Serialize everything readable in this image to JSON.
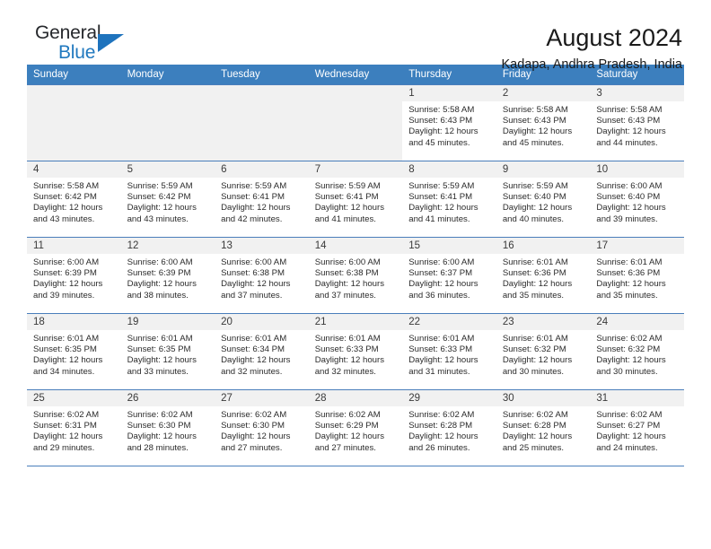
{
  "brand": {
    "name_top": "General",
    "name_bottom": "Blue",
    "triangle_color": "#1e73bd",
    "blue_text_color": "#2179bf"
  },
  "header": {
    "title": "August 2024",
    "subtitle": "Kadapa, Andhra Pradesh, India",
    "header_bg_color": "#3c7fbe",
    "header_text_color": "#ffffff"
  },
  "calendar": {
    "weekday_headers": [
      "Sunday",
      "Monday",
      "Tuesday",
      "Wednesday",
      "Thursday",
      "Friday",
      "Saturday"
    ],
    "weeks": [
      [
        {
          "day": "",
          "empty": true
        },
        {
          "day": "",
          "empty": true
        },
        {
          "day": "",
          "empty": true
        },
        {
          "day": "",
          "empty": true
        },
        {
          "day": "1",
          "sunrise": "Sunrise: 5:58 AM",
          "sunset": "Sunset: 6:43 PM",
          "daylight_1": "Daylight: 12 hours",
          "daylight_2": "and 45 minutes."
        },
        {
          "day": "2",
          "sunrise": "Sunrise: 5:58 AM",
          "sunset": "Sunset: 6:43 PM",
          "daylight_1": "Daylight: 12 hours",
          "daylight_2": "and 45 minutes."
        },
        {
          "day": "3",
          "sunrise": "Sunrise: 5:58 AM",
          "sunset": "Sunset: 6:43 PM",
          "daylight_1": "Daylight: 12 hours",
          "daylight_2": "and 44 minutes."
        }
      ],
      [
        {
          "day": "4",
          "sunrise": "Sunrise: 5:58 AM",
          "sunset": "Sunset: 6:42 PM",
          "daylight_1": "Daylight: 12 hours",
          "daylight_2": "and 43 minutes."
        },
        {
          "day": "5",
          "sunrise": "Sunrise: 5:59 AM",
          "sunset": "Sunset: 6:42 PM",
          "daylight_1": "Daylight: 12 hours",
          "daylight_2": "and 43 minutes."
        },
        {
          "day": "6",
          "sunrise": "Sunrise: 5:59 AM",
          "sunset": "Sunset: 6:41 PM",
          "daylight_1": "Daylight: 12 hours",
          "daylight_2": "and 42 minutes."
        },
        {
          "day": "7",
          "sunrise": "Sunrise: 5:59 AM",
          "sunset": "Sunset: 6:41 PM",
          "daylight_1": "Daylight: 12 hours",
          "daylight_2": "and 41 minutes."
        },
        {
          "day": "8",
          "sunrise": "Sunrise: 5:59 AM",
          "sunset": "Sunset: 6:41 PM",
          "daylight_1": "Daylight: 12 hours",
          "daylight_2": "and 41 minutes."
        },
        {
          "day": "9",
          "sunrise": "Sunrise: 5:59 AM",
          "sunset": "Sunset: 6:40 PM",
          "daylight_1": "Daylight: 12 hours",
          "daylight_2": "and 40 minutes."
        },
        {
          "day": "10",
          "sunrise": "Sunrise: 6:00 AM",
          "sunset": "Sunset: 6:40 PM",
          "daylight_1": "Daylight: 12 hours",
          "daylight_2": "and 39 minutes."
        }
      ],
      [
        {
          "day": "11",
          "sunrise": "Sunrise: 6:00 AM",
          "sunset": "Sunset: 6:39 PM",
          "daylight_1": "Daylight: 12 hours",
          "daylight_2": "and 39 minutes."
        },
        {
          "day": "12",
          "sunrise": "Sunrise: 6:00 AM",
          "sunset": "Sunset: 6:39 PM",
          "daylight_1": "Daylight: 12 hours",
          "daylight_2": "and 38 minutes."
        },
        {
          "day": "13",
          "sunrise": "Sunrise: 6:00 AM",
          "sunset": "Sunset: 6:38 PM",
          "daylight_1": "Daylight: 12 hours",
          "daylight_2": "and 37 minutes."
        },
        {
          "day": "14",
          "sunrise": "Sunrise: 6:00 AM",
          "sunset": "Sunset: 6:38 PM",
          "daylight_1": "Daylight: 12 hours",
          "daylight_2": "and 37 minutes."
        },
        {
          "day": "15",
          "sunrise": "Sunrise: 6:00 AM",
          "sunset": "Sunset: 6:37 PM",
          "daylight_1": "Daylight: 12 hours",
          "daylight_2": "and 36 minutes."
        },
        {
          "day": "16",
          "sunrise": "Sunrise: 6:01 AM",
          "sunset": "Sunset: 6:36 PM",
          "daylight_1": "Daylight: 12 hours",
          "daylight_2": "and 35 minutes."
        },
        {
          "day": "17",
          "sunrise": "Sunrise: 6:01 AM",
          "sunset": "Sunset: 6:36 PM",
          "daylight_1": "Daylight: 12 hours",
          "daylight_2": "and 35 minutes."
        }
      ],
      [
        {
          "day": "18",
          "sunrise": "Sunrise: 6:01 AM",
          "sunset": "Sunset: 6:35 PM",
          "daylight_1": "Daylight: 12 hours",
          "daylight_2": "and 34 minutes."
        },
        {
          "day": "19",
          "sunrise": "Sunrise: 6:01 AM",
          "sunset": "Sunset: 6:35 PM",
          "daylight_1": "Daylight: 12 hours",
          "daylight_2": "and 33 minutes."
        },
        {
          "day": "20",
          "sunrise": "Sunrise: 6:01 AM",
          "sunset": "Sunset: 6:34 PM",
          "daylight_1": "Daylight: 12 hours",
          "daylight_2": "and 32 minutes."
        },
        {
          "day": "21",
          "sunrise": "Sunrise: 6:01 AM",
          "sunset": "Sunset: 6:33 PM",
          "daylight_1": "Daylight: 12 hours",
          "daylight_2": "and 32 minutes."
        },
        {
          "day": "22",
          "sunrise": "Sunrise: 6:01 AM",
          "sunset": "Sunset: 6:33 PM",
          "daylight_1": "Daylight: 12 hours",
          "daylight_2": "and 31 minutes."
        },
        {
          "day": "23",
          "sunrise": "Sunrise: 6:01 AM",
          "sunset": "Sunset: 6:32 PM",
          "daylight_1": "Daylight: 12 hours",
          "daylight_2": "and 30 minutes."
        },
        {
          "day": "24",
          "sunrise": "Sunrise: 6:02 AM",
          "sunset": "Sunset: 6:32 PM",
          "daylight_1": "Daylight: 12 hours",
          "daylight_2": "and 30 minutes."
        }
      ],
      [
        {
          "day": "25",
          "sunrise": "Sunrise: 6:02 AM",
          "sunset": "Sunset: 6:31 PM",
          "daylight_1": "Daylight: 12 hours",
          "daylight_2": "and 29 minutes."
        },
        {
          "day": "26",
          "sunrise": "Sunrise: 6:02 AM",
          "sunset": "Sunset: 6:30 PM",
          "daylight_1": "Daylight: 12 hours",
          "daylight_2": "and 28 minutes."
        },
        {
          "day": "27",
          "sunrise": "Sunrise: 6:02 AM",
          "sunset": "Sunset: 6:30 PM",
          "daylight_1": "Daylight: 12 hours",
          "daylight_2": "and 27 minutes."
        },
        {
          "day": "28",
          "sunrise": "Sunrise: 6:02 AM",
          "sunset": "Sunset: 6:29 PM",
          "daylight_1": "Daylight: 12 hours",
          "daylight_2": "and 27 minutes."
        },
        {
          "day": "29",
          "sunrise": "Sunrise: 6:02 AM",
          "sunset": "Sunset: 6:28 PM",
          "daylight_1": "Daylight: 12 hours",
          "daylight_2": "and 26 minutes."
        },
        {
          "day": "30",
          "sunrise": "Sunrise: 6:02 AM",
          "sunset": "Sunset: 6:28 PM",
          "daylight_1": "Daylight: 12 hours",
          "daylight_2": "and 25 minutes."
        },
        {
          "day": "31",
          "sunrise": "Sunrise: 6:02 AM",
          "sunset": "Sunset: 6:27 PM",
          "daylight_1": "Daylight: 12 hours",
          "daylight_2": "and 24 minutes."
        }
      ]
    ]
  }
}
